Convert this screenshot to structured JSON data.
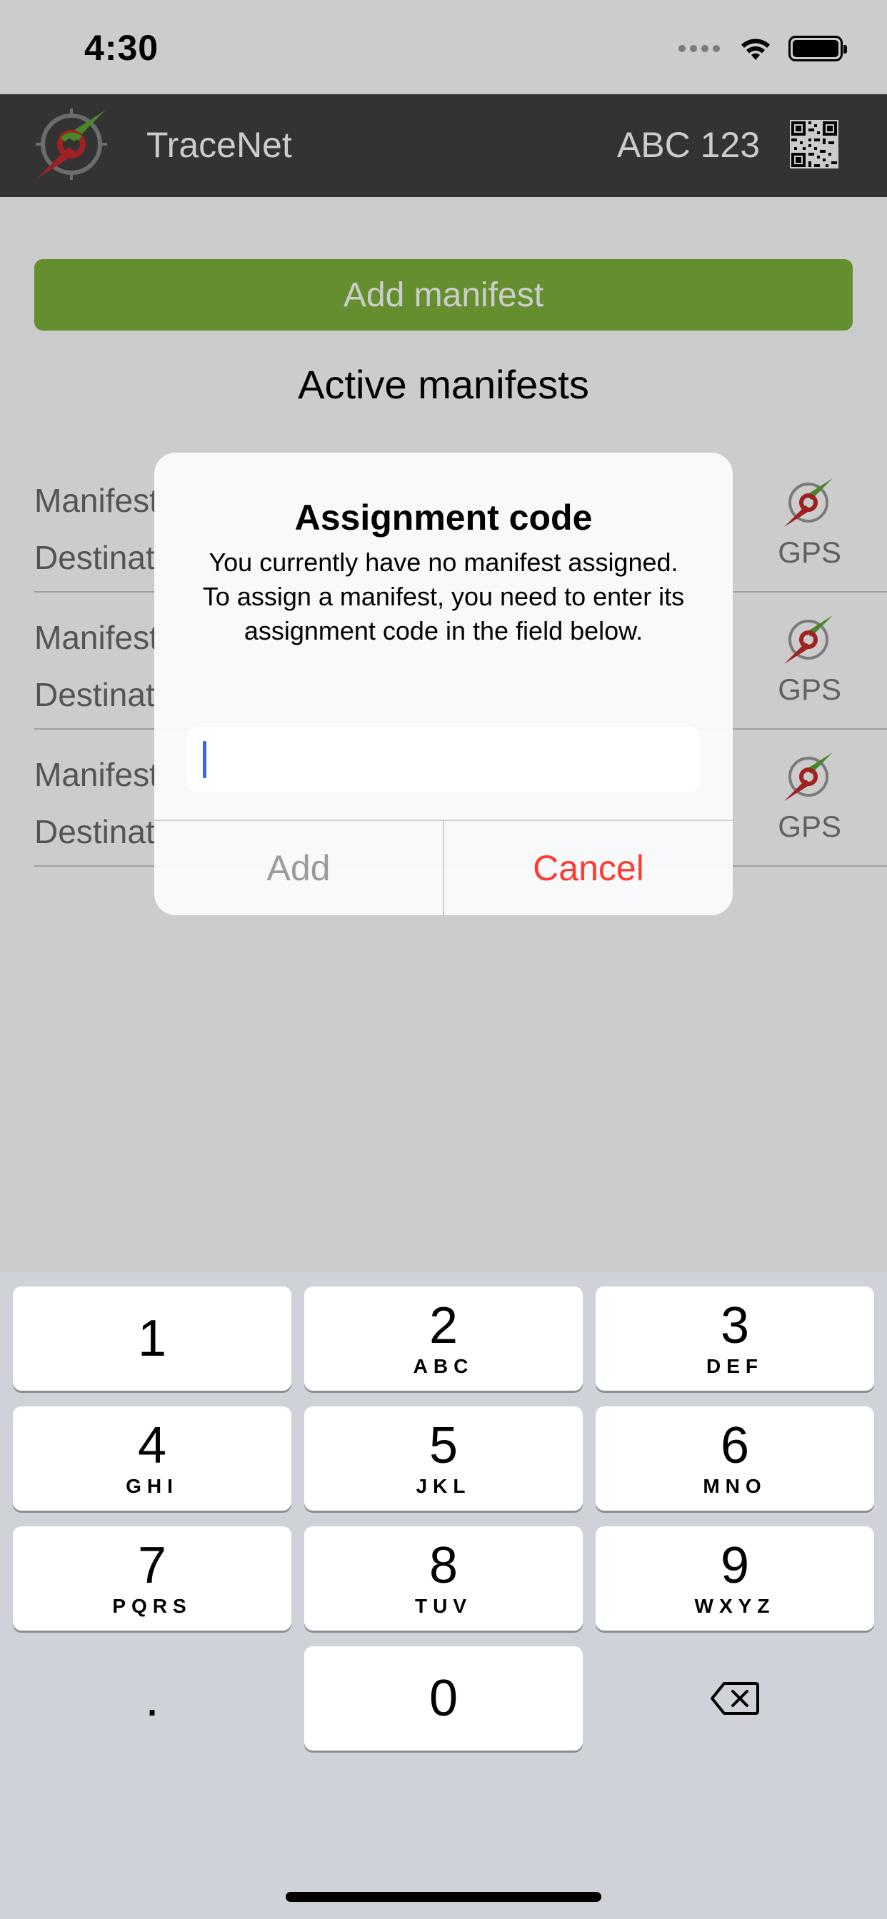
{
  "status_bar": {
    "time": "4:30"
  },
  "header": {
    "app_title": "TraceNet",
    "vehicle_id": "ABC 123"
  },
  "main": {
    "add_manifest_label": "Add manifest",
    "section_title": "Active manifests",
    "rows": [
      {
        "line1": "Manifest",
        "line2": "Destinat",
        "gps_label": "GPS"
      },
      {
        "line1": "Manifest",
        "line2": "Destinat",
        "gps_label": "GPS"
      },
      {
        "line1": "Manifest",
        "line2": "Destinat",
        "gps_label": "GPS"
      }
    ]
  },
  "dialog": {
    "title": "Assignment code",
    "message": "You currently have no manifest assigned. To assign a manifest, you need to enter its assignment code in the field below.",
    "input_value": "",
    "add_label": "Add",
    "cancel_label": "Cancel"
  },
  "keyboard": {
    "keys": [
      {
        "num": "1",
        "letters": ""
      },
      {
        "num": "2",
        "letters": "ABC"
      },
      {
        "num": "3",
        "letters": "DEF"
      },
      {
        "num": "4",
        "letters": "GHI"
      },
      {
        "num": "5",
        "letters": "JKL"
      },
      {
        "num": "6",
        "letters": "MNO"
      },
      {
        "num": "7",
        "letters": "PQRS"
      },
      {
        "num": "8",
        "letters": "TUV"
      },
      {
        "num": "9",
        "letters": "WXYZ"
      },
      {
        "num": ".",
        "letters": ""
      },
      {
        "num": "0",
        "letters": ""
      }
    ]
  },
  "colors": {
    "header_bg": "#404040",
    "accent_green": "#7fb33a",
    "cancel_red": "#ff3b30",
    "caret_blue": "#3b63f0"
  }
}
